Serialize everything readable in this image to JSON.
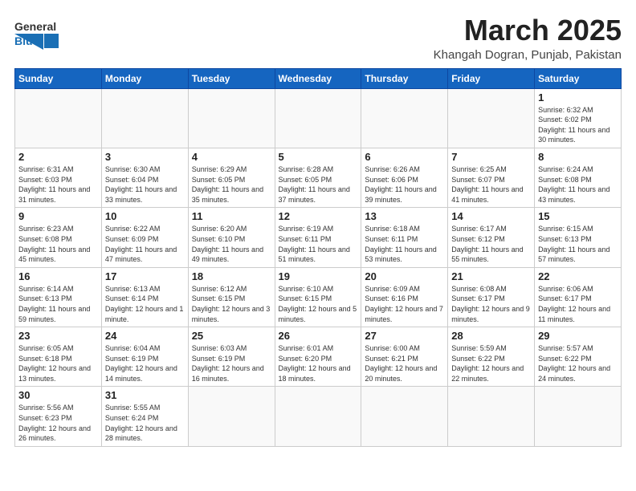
{
  "header": {
    "logo_line1": "General",
    "logo_line2": "Blue",
    "month": "March 2025",
    "location": "Khangah Dogran, Punjab, Pakistan"
  },
  "weekdays": [
    "Sunday",
    "Monday",
    "Tuesday",
    "Wednesday",
    "Thursday",
    "Friday",
    "Saturday"
  ],
  "weeks": [
    [
      {
        "day": "",
        "info": ""
      },
      {
        "day": "",
        "info": ""
      },
      {
        "day": "",
        "info": ""
      },
      {
        "day": "",
        "info": ""
      },
      {
        "day": "",
        "info": ""
      },
      {
        "day": "",
        "info": ""
      },
      {
        "day": "1",
        "info": "Sunrise: 6:32 AM\nSunset: 6:02 PM\nDaylight: 11 hours and 30 minutes."
      }
    ],
    [
      {
        "day": "2",
        "info": "Sunrise: 6:31 AM\nSunset: 6:03 PM\nDaylight: 11 hours and 31 minutes."
      },
      {
        "day": "3",
        "info": "Sunrise: 6:30 AM\nSunset: 6:04 PM\nDaylight: 11 hours and 33 minutes."
      },
      {
        "day": "4",
        "info": "Sunrise: 6:29 AM\nSunset: 6:05 PM\nDaylight: 11 hours and 35 minutes."
      },
      {
        "day": "5",
        "info": "Sunrise: 6:28 AM\nSunset: 6:05 PM\nDaylight: 11 hours and 37 minutes."
      },
      {
        "day": "6",
        "info": "Sunrise: 6:26 AM\nSunset: 6:06 PM\nDaylight: 11 hours and 39 minutes."
      },
      {
        "day": "7",
        "info": "Sunrise: 6:25 AM\nSunset: 6:07 PM\nDaylight: 11 hours and 41 minutes."
      },
      {
        "day": "8",
        "info": "Sunrise: 6:24 AM\nSunset: 6:08 PM\nDaylight: 11 hours and 43 minutes."
      }
    ],
    [
      {
        "day": "9",
        "info": "Sunrise: 6:23 AM\nSunset: 6:08 PM\nDaylight: 11 hours and 45 minutes."
      },
      {
        "day": "10",
        "info": "Sunrise: 6:22 AM\nSunset: 6:09 PM\nDaylight: 11 hours and 47 minutes."
      },
      {
        "day": "11",
        "info": "Sunrise: 6:20 AM\nSunset: 6:10 PM\nDaylight: 11 hours and 49 minutes."
      },
      {
        "day": "12",
        "info": "Sunrise: 6:19 AM\nSunset: 6:11 PM\nDaylight: 11 hours and 51 minutes."
      },
      {
        "day": "13",
        "info": "Sunrise: 6:18 AM\nSunset: 6:11 PM\nDaylight: 11 hours and 53 minutes."
      },
      {
        "day": "14",
        "info": "Sunrise: 6:17 AM\nSunset: 6:12 PM\nDaylight: 11 hours and 55 minutes."
      },
      {
        "day": "15",
        "info": "Sunrise: 6:15 AM\nSunset: 6:13 PM\nDaylight: 11 hours and 57 minutes."
      }
    ],
    [
      {
        "day": "16",
        "info": "Sunrise: 6:14 AM\nSunset: 6:13 PM\nDaylight: 11 hours and 59 minutes."
      },
      {
        "day": "17",
        "info": "Sunrise: 6:13 AM\nSunset: 6:14 PM\nDaylight: 12 hours and 1 minute."
      },
      {
        "day": "18",
        "info": "Sunrise: 6:12 AM\nSunset: 6:15 PM\nDaylight: 12 hours and 3 minutes."
      },
      {
        "day": "19",
        "info": "Sunrise: 6:10 AM\nSunset: 6:15 PM\nDaylight: 12 hours and 5 minutes."
      },
      {
        "day": "20",
        "info": "Sunrise: 6:09 AM\nSunset: 6:16 PM\nDaylight: 12 hours and 7 minutes."
      },
      {
        "day": "21",
        "info": "Sunrise: 6:08 AM\nSunset: 6:17 PM\nDaylight: 12 hours and 9 minutes."
      },
      {
        "day": "22",
        "info": "Sunrise: 6:06 AM\nSunset: 6:17 PM\nDaylight: 12 hours and 11 minutes."
      }
    ],
    [
      {
        "day": "23",
        "info": "Sunrise: 6:05 AM\nSunset: 6:18 PM\nDaylight: 12 hours and 13 minutes."
      },
      {
        "day": "24",
        "info": "Sunrise: 6:04 AM\nSunset: 6:19 PM\nDaylight: 12 hours and 14 minutes."
      },
      {
        "day": "25",
        "info": "Sunrise: 6:03 AM\nSunset: 6:19 PM\nDaylight: 12 hours and 16 minutes."
      },
      {
        "day": "26",
        "info": "Sunrise: 6:01 AM\nSunset: 6:20 PM\nDaylight: 12 hours and 18 minutes."
      },
      {
        "day": "27",
        "info": "Sunrise: 6:00 AM\nSunset: 6:21 PM\nDaylight: 12 hours and 20 minutes."
      },
      {
        "day": "28",
        "info": "Sunrise: 5:59 AM\nSunset: 6:22 PM\nDaylight: 12 hours and 22 minutes."
      },
      {
        "day": "29",
        "info": "Sunrise: 5:57 AM\nSunset: 6:22 PM\nDaylight: 12 hours and 24 minutes."
      }
    ],
    [
      {
        "day": "30",
        "info": "Sunrise: 5:56 AM\nSunset: 6:23 PM\nDaylight: 12 hours and 26 minutes."
      },
      {
        "day": "31",
        "info": "Sunrise: 5:55 AM\nSunset: 6:24 PM\nDaylight: 12 hours and 28 minutes."
      },
      {
        "day": "",
        "info": ""
      },
      {
        "day": "",
        "info": ""
      },
      {
        "day": "",
        "info": ""
      },
      {
        "day": "",
        "info": ""
      },
      {
        "day": "",
        "info": ""
      }
    ]
  ]
}
